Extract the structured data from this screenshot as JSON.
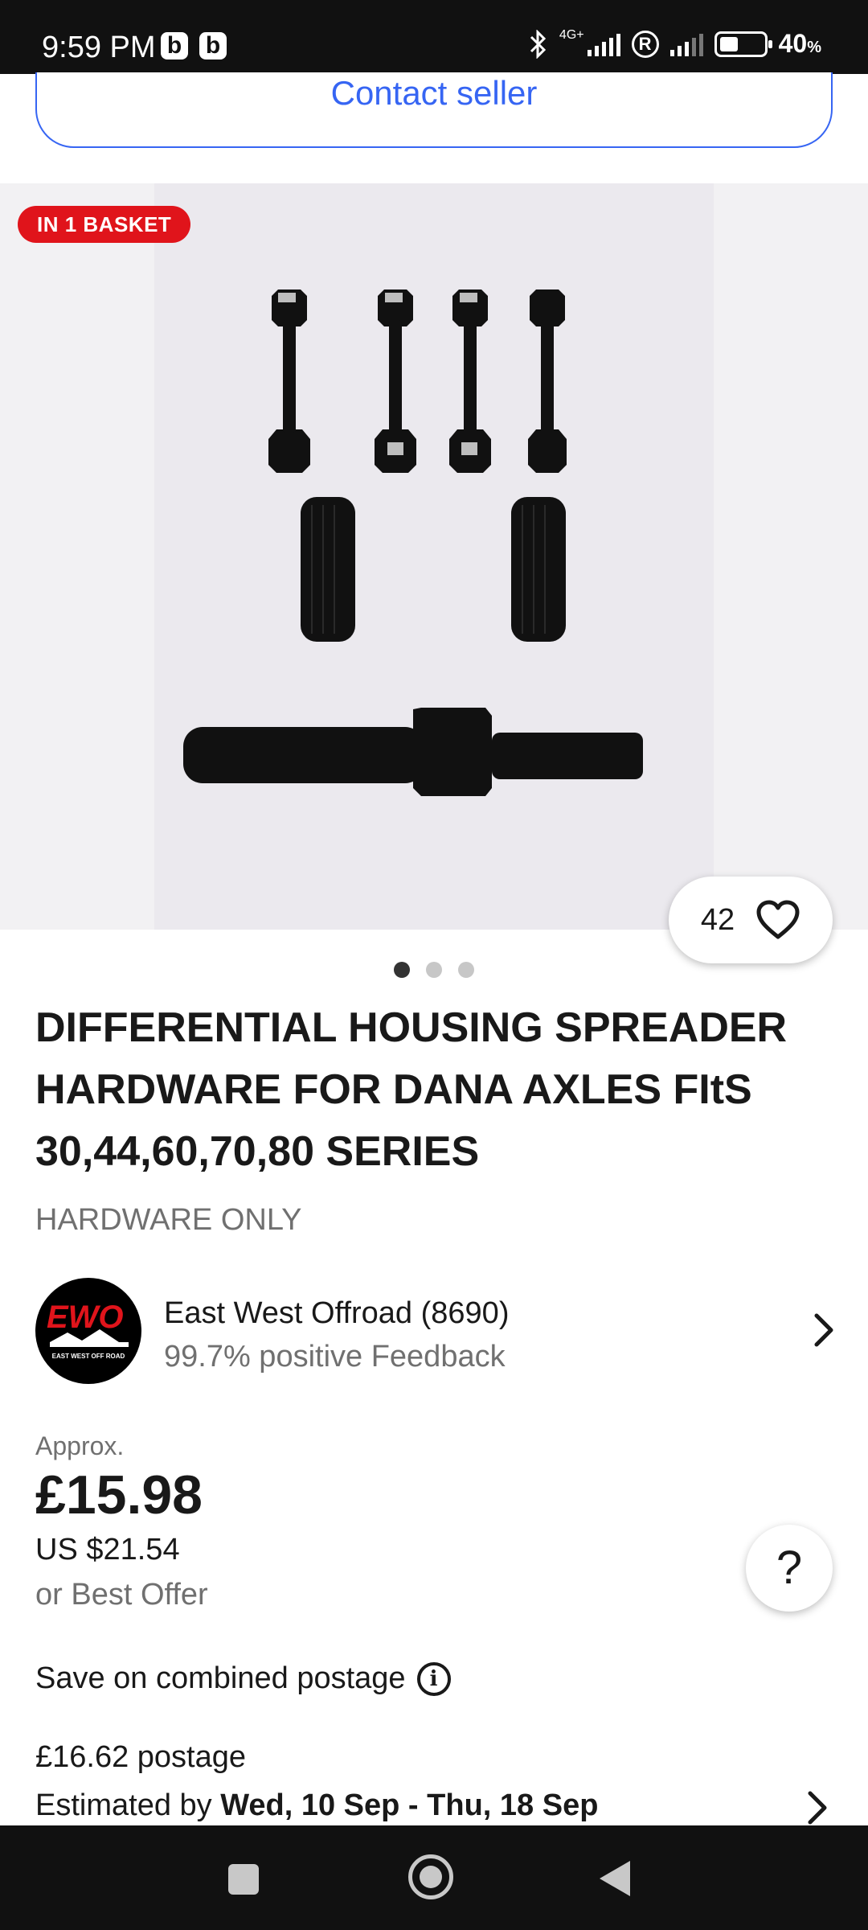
{
  "status_bar": {
    "time": "9:59 PM",
    "app_badge": "b",
    "network": "4G+",
    "battery_level": 0.4,
    "battery_text": "40",
    "battery_unit": "%"
  },
  "contact_seller": {
    "label": "Contact seller"
  },
  "gallery": {
    "badge": "IN 1 BASKET",
    "watch_count": "42",
    "image_count": 3,
    "active_image": 0
  },
  "listing": {
    "title": "DIFFERENTIAL HOUSING SPREADER HARDWARE FOR DANA AXLES FItS 30,44,60,70,80 SERIES",
    "subtitle": "HARDWARE ONLY"
  },
  "seller": {
    "logo_text": "EWO",
    "logo_subtext": "EAST WEST OFF ROAD",
    "name": "East West Offroad (8690)",
    "feedback": "99.7% positive Feedback"
  },
  "price": {
    "approx_label": "Approx.",
    "gbp": "£15.98",
    "usd": "US $21.54",
    "best_offer": "or Best Offer"
  },
  "help": {
    "label": "?"
  },
  "shipping": {
    "combined_label": "Save on combined postage",
    "postage": "£16.62 postage",
    "estimated_prefix": "Estimated by ",
    "estimated_dates": "Wed, 10 Sep - Thu, 18 Sep"
  },
  "colors": {
    "accent_blue": "#3665f3",
    "badge_red": "#e0141b",
    "text_primary": "#191919",
    "text_secondary": "#707070"
  }
}
